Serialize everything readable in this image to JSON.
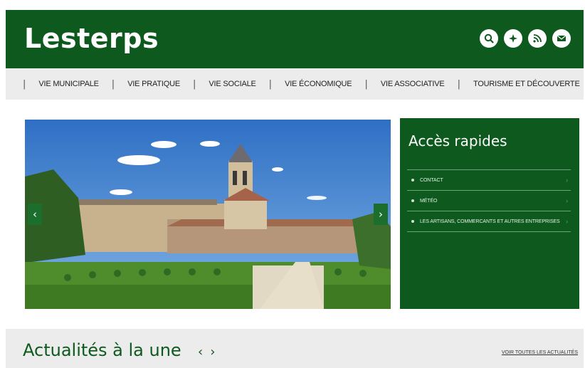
{
  "header": {
    "site_title": "Lesterps",
    "icons": [
      "search-icon",
      "compass-icon",
      "rss-icon",
      "mail-icon"
    ]
  },
  "nav": {
    "items": [
      "VIE MUNICIPALE",
      "VIE PRATIQUE",
      "VIE SOCIALE",
      "VIE ÉCONOMIQUE",
      "VIE ASSOCIATIVE",
      "TOURISME ET DÉCOUVERTE"
    ]
  },
  "slider": {
    "prev_label": "‹",
    "next_label": "›"
  },
  "quick_access": {
    "title": "Accès rapides",
    "items": [
      "CONTACT",
      "MÉTÉO",
      "LES ARTISANS, COMMERCANTS ET AUTRES ENTREPRISES"
    ]
  },
  "news": {
    "title": "Actualités à la une",
    "prev": "‹",
    "next": "›",
    "see_all": "VOIR TOUTES LES ACTUALITÉS"
  },
  "colors": {
    "brand_green": "#0e5a1e",
    "nav_bg": "#ececec"
  }
}
